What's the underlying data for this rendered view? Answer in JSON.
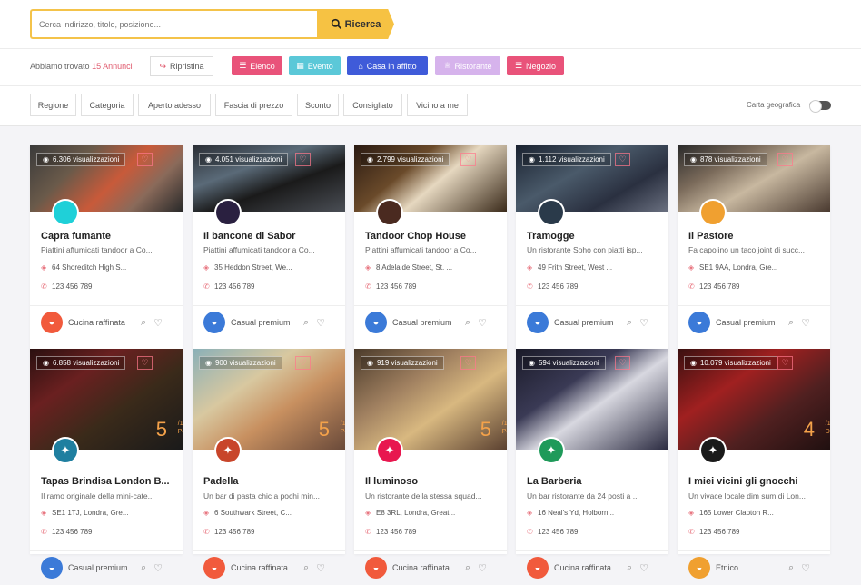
{
  "search": {
    "placeholder": "Cerca indirizzo, titolo, posizione...",
    "button_label": "Ricerca"
  },
  "results": {
    "found_prefix": "Abbiamo trovato",
    "count_text": "15 Annunci",
    "reset_label": "Ripristina"
  },
  "categories": [
    {
      "label": "Elenco",
      "color": "#e9537a",
      "icon": "list-icon"
    },
    {
      "label": "Evento",
      "color": "#5bc8d8",
      "icon": "calendar-icon"
    },
    {
      "label": "Casa in affitto",
      "color": "#3f5bd9",
      "icon": "home-icon"
    },
    {
      "label": "Ristorante",
      "color": "#d6b3ec",
      "icon": "trophy-icon"
    },
    {
      "label": "Negozio",
      "color": "#e9537a",
      "icon": "list-icon"
    }
  ],
  "filters": [
    "Regione",
    "Categoria",
    "Aperto adesso",
    "Fascia di prezzo",
    "Sconto",
    "Consigliato",
    "Vicino a me"
  ],
  "map_toggle_label": "Carta geografica",
  "colors": {
    "accent": "#f6c243",
    "pink": "#e9537a"
  },
  "listings_row1": [
    {
      "views": "6.306 visualizzazioni",
      "name": "Capra fumante",
      "desc": "Piattini affumicati tandoor a Co...",
      "address": "64 Shoreditch High S...",
      "phone": "123 456 789",
      "type": "Cucina raffinata",
      "type_color": "#f15a3c",
      "logo_color": "#1fd0d8"
    },
    {
      "views": "4.051 visualizzazioni",
      "name": "Il bancone di Sabor",
      "desc": "Piattini affumicati tandoor a Co...",
      "address": "35 Heddon Street, We...",
      "phone": "123 456 789",
      "type": "Casual premium",
      "type_color": "#3b7ad8",
      "logo_color": "#2a2040"
    },
    {
      "views": "2.799 visualizzazioni",
      "name": "Tandoor Chop House",
      "desc": "Piattini affumicati tandoor a Co...",
      "address": "8 Adelaide Street, St. ...",
      "phone": "123 456 789",
      "type": "Casual premium",
      "type_color": "#3b7ad8",
      "logo_color": "#4a2a20"
    },
    {
      "views": "1.112 visualizzazioni",
      "name": "Tramogge",
      "desc": "Un ristorante Soho con piatti isp...",
      "address": "49 Frith Street, West ...",
      "phone": "123 456 789",
      "type": "Casual premium",
      "type_color": "#3b7ad8",
      "logo_color": "#2a3a4a"
    },
    {
      "views": "878 visualizzazioni",
      "name": "Il Pastore",
      "desc": "Fa capolino un taco joint di succ...",
      "address": "SE1 9AA, Londra, Gre...",
      "phone": "123 456 789",
      "type": "Casual premium",
      "type_color": "#3b7ad8",
      "logo_color": "#f0a030"
    }
  ],
  "listings_row2": [
    {
      "views": "6.858 visualizzazioni",
      "name": "Tapas Brindisa London B...",
      "desc": "Il ramo originale della mini-cate...",
      "address": "SE1 1TJ, Londra, Gre...",
      "phone": "123 456 789",
      "type": "Casual premium",
      "type_color": "#3b7ad8",
      "logo_color": "#1f7fa0",
      "rating": "5",
      "rating_sub": "/10",
      "rating_word": "Povero"
    },
    {
      "views": "900 visualizzazioni",
      "name": "Padella",
      "desc": "Un bar di pasta chic a pochi min...",
      "address": "6 Southwark Street, C...",
      "phone": "123 456 789",
      "type": "Cucina raffinata",
      "type_color": "#f15a3c",
      "logo_color": "#c8452a",
      "rating": "5",
      "rating_sub": "/10",
      "rating_word": "Povero"
    },
    {
      "views": "919 visualizzazioni",
      "name": "Il luminoso",
      "desc": "Un ristorante della stessa squad...",
      "address": "E8 3RL, Londra, Great...",
      "phone": "123 456 789",
      "type": "Cucina raffinata",
      "type_color": "#f15a3c",
      "logo_color": "#e8174f",
      "rating": "5",
      "rating_sub": "/10",
      "rating_word": "Povero"
    },
    {
      "views": "594 visualizzazioni",
      "name": "La Barberia",
      "desc": "Un bar ristorante da 24 posti a ...",
      "address": "16 Neal's Yd, Holborn...",
      "phone": "123 456 789",
      "type": "Cucina raffinata",
      "type_color": "#f15a3c",
      "logo_color": "#1f9a5a"
    },
    {
      "views": "10.079 visualizzazioni",
      "name": "I miei vicini gli gnocchi",
      "desc": "Un vivace locale dim sum di Lon...",
      "address": "165 Lower Clapton R...",
      "phone": "123 456 789",
      "type": "Etnico",
      "type_color": "#f0a030",
      "logo_color": "#1a1a1a",
      "rating": "4",
      "rating_sub": "/10",
      "rating_word": "Debole"
    }
  ]
}
